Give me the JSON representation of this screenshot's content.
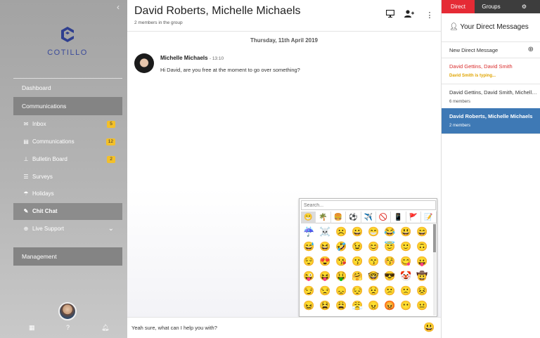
{
  "sidebar": {
    "collapse_icon": "chevron-left-icon",
    "logo_text": "COTILLO",
    "dashboard_label": "Dashboard",
    "communications_label": "Communications",
    "items": [
      {
        "label": "Inbox",
        "icon": "envelope-icon",
        "badge": "5"
      },
      {
        "label": "Communications",
        "icon": "card-icon",
        "badge": "12"
      },
      {
        "label": "Bulletin Board",
        "icon": "pin-icon",
        "badge": "2"
      },
      {
        "label": "Surveys",
        "icon": "list-icon",
        "badge": ""
      },
      {
        "label": "Holidays",
        "icon": "umbrella-icon",
        "badge": ""
      },
      {
        "label": "Chit Chat",
        "icon": "chat-icon",
        "badge": ""
      },
      {
        "label": "Live Support",
        "icon": "support-icon",
        "badge": ""
      }
    ],
    "management_label": "Management",
    "footer_icons": [
      "grid-icon",
      "help-icon",
      "bell-icon"
    ]
  },
  "chat": {
    "title": "David Roberts, Michelle Michaels",
    "subtitle": "2 members in the group",
    "date_separator": "Thursday, 11th April 2019",
    "messages": [
      {
        "author": "Michelle Michaels",
        "time": "13:10",
        "text": "Hi David, are you free at the moment to go over something?"
      }
    ],
    "input_value": "Yeah sure, what can I help you with?",
    "emoji_toggle": "😃"
  },
  "emoji_picker": {
    "search_placeholder": "Search...",
    "categories": [
      "😁",
      "🌴",
      "🍔",
      "⚽",
      "✈️",
      "🚫",
      "📱",
      "🚩",
      "📝"
    ],
    "emojis": [
      "☔",
      "☠️",
      "☹️",
      "😀",
      "😁",
      "😂",
      "😃",
      "😄",
      "😅",
      "😆",
      "🤣",
      "😉",
      "😊",
      "😇",
      "🙂",
      "🙃",
      "😌",
      "😍",
      "😘",
      "😗",
      "😙",
      "😚",
      "😋",
      "😛",
      "😜",
      "😝",
      "🤑",
      "🤗",
      "🤓",
      "😎",
      "🤡",
      "🤠",
      "😏",
      "😒",
      "😞",
      "😔",
      "😟",
      "😕",
      "🙁",
      "😣",
      "😖",
      "😫",
      "😩",
      "😤",
      "😠",
      "😡",
      "😶",
      "😐"
    ]
  },
  "right_panel": {
    "tabs": [
      "Direct",
      "Groups"
    ],
    "settings_icon": "gear-icon",
    "title": "Your Direct Messages",
    "new_label": "New Direct Message",
    "conversations": [
      {
        "title": "David Gettins, David Smith",
        "sub": "David Smith is typing..."
      },
      {
        "title": "David Gettins, David Smith, Michelle Michaels",
        "sub": "6 members"
      },
      {
        "title": "David Roberts, Michelle Michaels",
        "sub": "2 members"
      }
    ]
  }
}
